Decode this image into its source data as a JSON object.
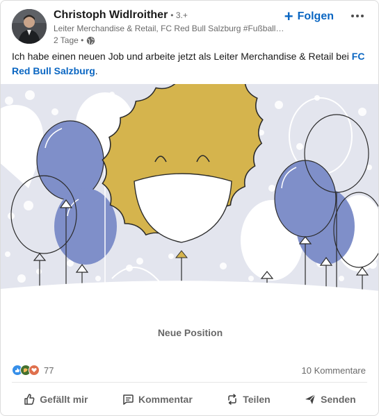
{
  "author": {
    "name": "Christoph Widlroither",
    "degree": "• 3.+",
    "headline": "Leiter Merchandise & Retail, FC Red Bull Salzburg #Fußballvo...",
    "time": "2 Tage •",
    "visibility_icon": "globe-icon"
  },
  "header": {
    "follow_label": "Folgen",
    "more_icon": "ellipsis-icon"
  },
  "post": {
    "text_prefix": "Ich habe einen neuen Job und arbeite jetzt als Leiter Merchandise & Retail bei ",
    "mention": "FC Red Bull Salzburg",
    "text_suffix": "."
  },
  "image": {
    "caption": "Neue Position",
    "colors": {
      "background": "#e3e5ee",
      "balloon_blue": "#7f8fc9",
      "sun": "#d5b44d"
    }
  },
  "social": {
    "reaction_count": "77",
    "reaction_icons": [
      "like-icon",
      "celebrate-icon",
      "love-icon"
    ],
    "comments": "10 Kommentare"
  },
  "actions": [
    {
      "label": "Gefällt mir",
      "icon": "thumbs-up-icon"
    },
    {
      "label": "Kommentar",
      "icon": "comment-icon"
    },
    {
      "label": "Teilen",
      "icon": "repost-icon"
    },
    {
      "label": "Senden",
      "icon": "send-icon"
    }
  ],
  "colors": {
    "accent": "#0a66c2"
  }
}
